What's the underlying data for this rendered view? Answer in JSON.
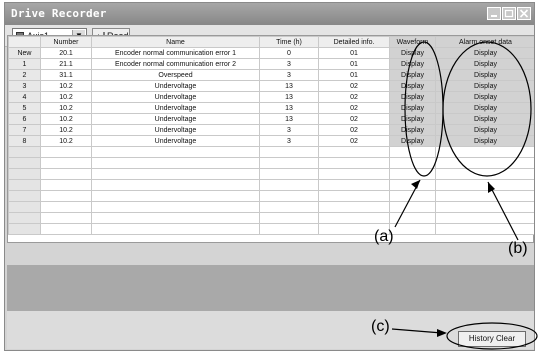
{
  "window": {
    "title": "Drive Recorder"
  },
  "toolbar": {
    "axis_value": "Axis1",
    "read_label": "Read"
  },
  "table": {
    "columns": [
      "",
      "Number",
      "Name",
      "Time (h)",
      "Detailed info.",
      "Waveform",
      "Alarm onset data"
    ],
    "rows": [
      [
        "New",
        "20.1",
        "Encoder normal communication error 1",
        "0",
        "01",
        "Display",
        "Display"
      ],
      [
        "1",
        "21.1",
        "Encoder normal communication error 2",
        "3",
        "01",
        "Display",
        "Display"
      ],
      [
        "2",
        "31.1",
        "Overspeed",
        "3",
        "01",
        "Display",
        "Display"
      ],
      [
        "3",
        "10.2",
        "Undervoltage",
        "13",
        "02",
        "Display",
        "Display"
      ],
      [
        "4",
        "10.2",
        "Undervoltage",
        "13",
        "02",
        "Display",
        "Display"
      ],
      [
        "5",
        "10.2",
        "Undervoltage",
        "13",
        "02",
        "Display",
        "Display"
      ],
      [
        "6",
        "10.2",
        "Undervoltage",
        "13",
        "02",
        "Display",
        "Display"
      ],
      [
        "7",
        "10.2",
        "Undervoltage",
        "3",
        "02",
        "Display",
        "Display"
      ],
      [
        "8",
        "10.2",
        "Undervoltage",
        "3",
        "02",
        "Display",
        "Display"
      ]
    ],
    "empty_rows": 8
  },
  "footer": {
    "history_clear_label": "History Clear"
  },
  "callouts": {
    "a": "(a)",
    "b": "(b)",
    "c": "(c)"
  },
  "icons": {
    "axis": "axis-icon",
    "read": "read-arrow-icon",
    "dropdown": "chevron-down-icon"
  },
  "colors": {
    "title_bar": "#979797",
    "grid_background": "#ffffff",
    "lower_panel": "#a9a9a9",
    "action_cell": "#d2d2d2"
  }
}
